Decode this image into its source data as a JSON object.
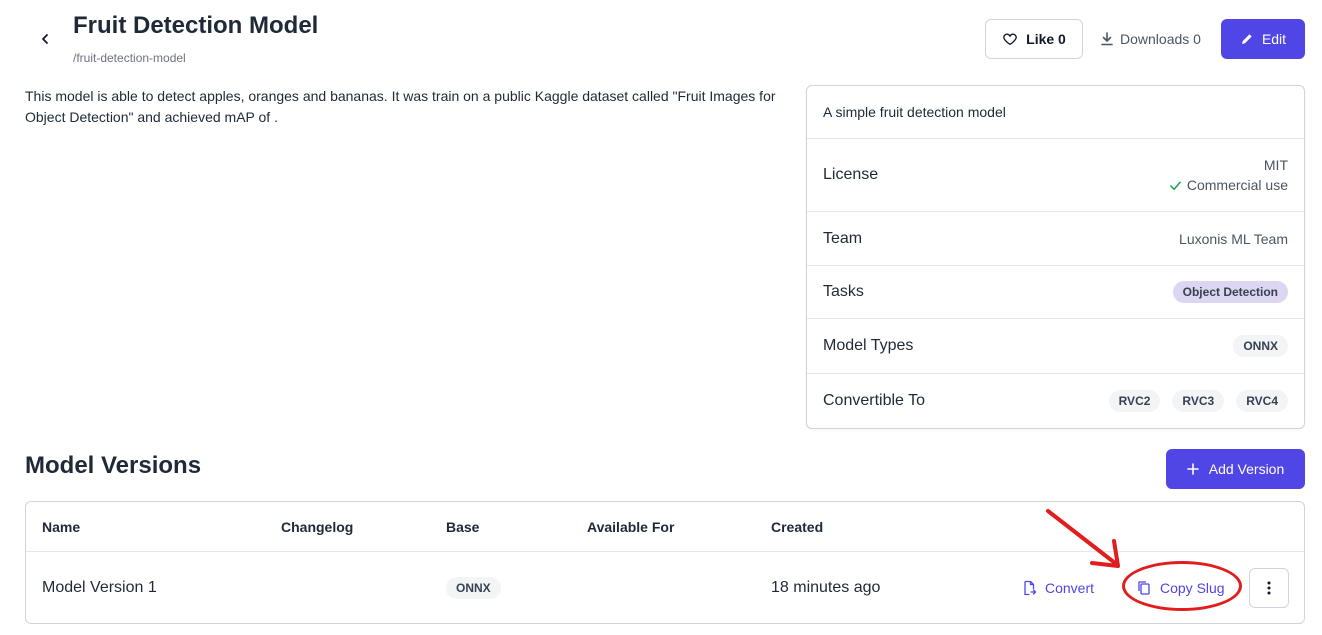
{
  "header": {
    "title": "Fruit Detection Model",
    "slug": "/fruit-detection-model",
    "like_label": "Like 0",
    "downloads_label": "Downloads 0",
    "edit_label": "Edit"
  },
  "description": "This model is able to detect apples, oranges and bananas. It was train on a public Kaggle dataset called \"Fruit Images for Object Detection\" and achieved mAP of .",
  "info_card": {
    "summary": "A simple fruit detection model",
    "license_label": "License",
    "license_value": "MIT",
    "commercial_use": "Commercial use",
    "team_label": "Team",
    "team_value": "Luxonis ML Team",
    "tasks_label": "Tasks",
    "tasks": [
      "Object Detection"
    ],
    "model_types_label": "Model Types",
    "model_types": [
      "ONNX"
    ],
    "convertible_label": "Convertible To",
    "convertible_to": [
      "RVC2",
      "RVC3",
      "RVC4"
    ]
  },
  "versions": {
    "title": "Model Versions",
    "add_label": "Add Version",
    "columns": [
      "Name",
      "Changelog",
      "Base",
      "Available For",
      "Created"
    ],
    "rows": [
      {
        "name": "Model Version 1",
        "changelog": "",
        "base": "ONNX",
        "available_for": "",
        "created": "18 minutes ago",
        "convert_label": "Convert",
        "copy_slug_label": "Copy Slug"
      }
    ]
  },
  "colors": {
    "accent": "#4f46e5",
    "annotation": "#e11d1d",
    "success": "#16a34a",
    "task_badge": "#ddd6f3"
  }
}
